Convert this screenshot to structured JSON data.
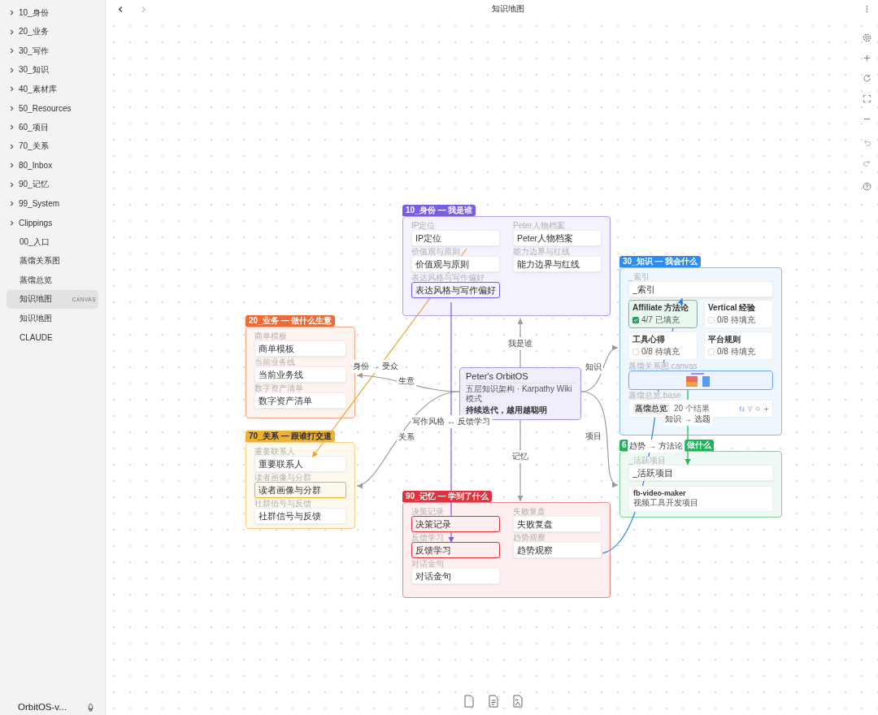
{
  "sidebar": {
    "items": [
      {
        "label": "10_身份",
        "kind": "folder",
        "selected": false
      },
      {
        "label": "20_业务",
        "kind": "folder",
        "selected": false
      },
      {
        "label": "30_写作",
        "kind": "folder",
        "selected": false
      },
      {
        "label": "30_知识",
        "kind": "folder",
        "selected": false
      },
      {
        "label": "40_素材库",
        "kind": "folder",
        "selected": false
      },
      {
        "label": "50_Resources",
        "kind": "folder",
        "selected": false
      },
      {
        "label": "60_项目",
        "kind": "folder",
        "selected": false
      },
      {
        "label": "70_关系",
        "kind": "folder",
        "selected": false
      },
      {
        "label": "80_Inbox",
        "kind": "folder",
        "selected": false
      },
      {
        "label": "90_记忆",
        "kind": "folder",
        "selected": false
      },
      {
        "label": "99_System",
        "kind": "folder",
        "selected": false
      },
      {
        "label": "Clippings",
        "kind": "folder",
        "selected": false
      },
      {
        "label": "00_入口",
        "kind": "file",
        "selected": false
      },
      {
        "label": "蒸馏关系图",
        "kind": "file",
        "selected": false
      },
      {
        "label": "蒸馏总览",
        "kind": "file",
        "selected": false
      },
      {
        "label": "知识地图",
        "kind": "file",
        "selected": true,
        "badge": "CANVAS"
      },
      {
        "label": "知识地图",
        "kind": "file",
        "selected": false
      },
      {
        "label": "CLAUDE",
        "kind": "file",
        "selected": false
      }
    ],
    "vault": "OrbitOS-v..."
  },
  "header": {
    "title": "知识地图"
  },
  "canvas": {
    "center": {
      "title": "Peter's OrbitOS",
      "subtitle": "五层知识架构 · Karpathy Wiki 模式",
      "tagline": "持续迭代，越用越聪明"
    },
    "groups": [
      {
        "title": "10_身份 — 我是谁",
        "color": "#7b5ce6",
        "cards": [
          {
            "kind": "note",
            "label": "IP定位",
            "text": "IP定位",
            "highlighted": false
          },
          {
            "kind": "note",
            "label": "Peter人物档案",
            "text": "Peter人物档案",
            "highlighted": false
          },
          {
            "kind": "note",
            "label": "价值观与原则",
            "text": "价值观与原则",
            "highlighted": false
          },
          {
            "kind": "note",
            "label": "能力边界与红线",
            "text": "能力边界与红线",
            "highlighted": false
          },
          {
            "kind": "note",
            "label": "表达风格与写作偏好",
            "text": "表达风格与写作偏好",
            "highlighted": true
          }
        ]
      },
      {
        "title": "20_业务 — 做什么生意",
        "color": "#f06a35",
        "cards": [
          {
            "kind": "note",
            "label": "商单模板",
            "text": "商单模板",
            "highlighted": false
          },
          {
            "kind": "note",
            "label": "当前业务线",
            "text": "当前业务线",
            "highlighted": false
          },
          {
            "kind": "note",
            "label": "数字资产清单",
            "text": "数字资产清单",
            "highlighted": false
          }
        ]
      },
      {
        "title": "70_关系 — 跟谁打交道",
        "color": "#f0b030",
        "cards": [
          {
            "kind": "note",
            "label": "重要联系人",
            "text": "重要联系人",
            "highlighted": false
          },
          {
            "kind": "note",
            "label": "读者画像与分群",
            "text": "读者画像与分群",
            "highlighted": true
          },
          {
            "kind": "note",
            "label": "社群信号与反馈",
            "text": "社群信号与反馈",
            "highlighted": false
          }
        ]
      },
      {
        "title": "30_知识 — 我会什么",
        "color": "#2d8cf0",
        "cards": [
          {
            "kind": "note",
            "label": "_索引",
            "text": "_索引",
            "highlighted": false
          },
          {
            "kind": "progress",
            "title": "Affiliate 方法论",
            "status": "4/7 已填充",
            "done": true
          },
          {
            "kind": "progress",
            "title": "Vertical 经验",
            "status": "0/8 待填充",
            "done": false
          },
          {
            "kind": "progress",
            "title": "工具心得",
            "status": "0/8 待填充",
            "done": false
          },
          {
            "kind": "progress",
            "title": "平台规则",
            "status": "0/8 待填充",
            "done": false
          },
          {
            "kind": "canvas-embed",
            "label": "蒸馏关系图.canvas"
          },
          {
            "kind": "base-embed",
            "label": "蒸馏总览.base",
            "view": "蒸馏总览",
            "count": "20 个结果"
          }
        ]
      },
      {
        "title_pieces": [
          "6",
          "做什么"
        ],
        "color": "#1fb35a",
        "cards": [
          {
            "kind": "note",
            "label": "_活跃项目",
            "text": "_活跃项目",
            "highlighted": false
          },
          {
            "kind": "project",
            "title": "fb-video-maker",
            "text": "视频工具开发项目"
          }
        ]
      },
      {
        "title": "90_记忆 — 学到了什么",
        "color": "#e0323c",
        "cards": [
          {
            "kind": "note",
            "label": "决策记录",
            "text": "决策记录",
            "highlighted": true
          },
          {
            "kind": "note",
            "label": "失败复盘",
            "text": "失败复盘",
            "highlighted": false
          },
          {
            "kind": "note",
            "label": "反馈学习",
            "text": "反馈学习",
            "highlighted": true
          },
          {
            "kind": "note",
            "label": "趋势观察",
            "text": "趋势观察",
            "highlighted": false
          },
          {
            "kind": "note",
            "label": "对话金句",
            "text": "对话金句",
            "highlighted": false
          }
        ]
      }
    ],
    "edges": [
      {
        "label": "我是谁",
        "color": "#9a9a9a"
      },
      {
        "label": "生意",
        "color": "#9a9a9a"
      },
      {
        "label": "关系",
        "color": "#9a9a9a"
      },
      {
        "label": "记忆",
        "color": "#9a9a9a"
      },
      {
        "label": "知识",
        "color": "#9a9a9a"
      },
      {
        "label": "项目",
        "color": "#9a9a9a"
      },
      {
        "label": "写作风格 ↔ 反馈学习",
        "color": "#7b5ce6"
      },
      {
        "label": "身份 → 受众",
        "color": "#e8a530"
      },
      {
        "label": "趋势 → 方法论",
        "color": "#2d7ff0"
      },
      {
        "label": "知识 → 选题",
        "color": "#1fb35a"
      }
    ]
  }
}
